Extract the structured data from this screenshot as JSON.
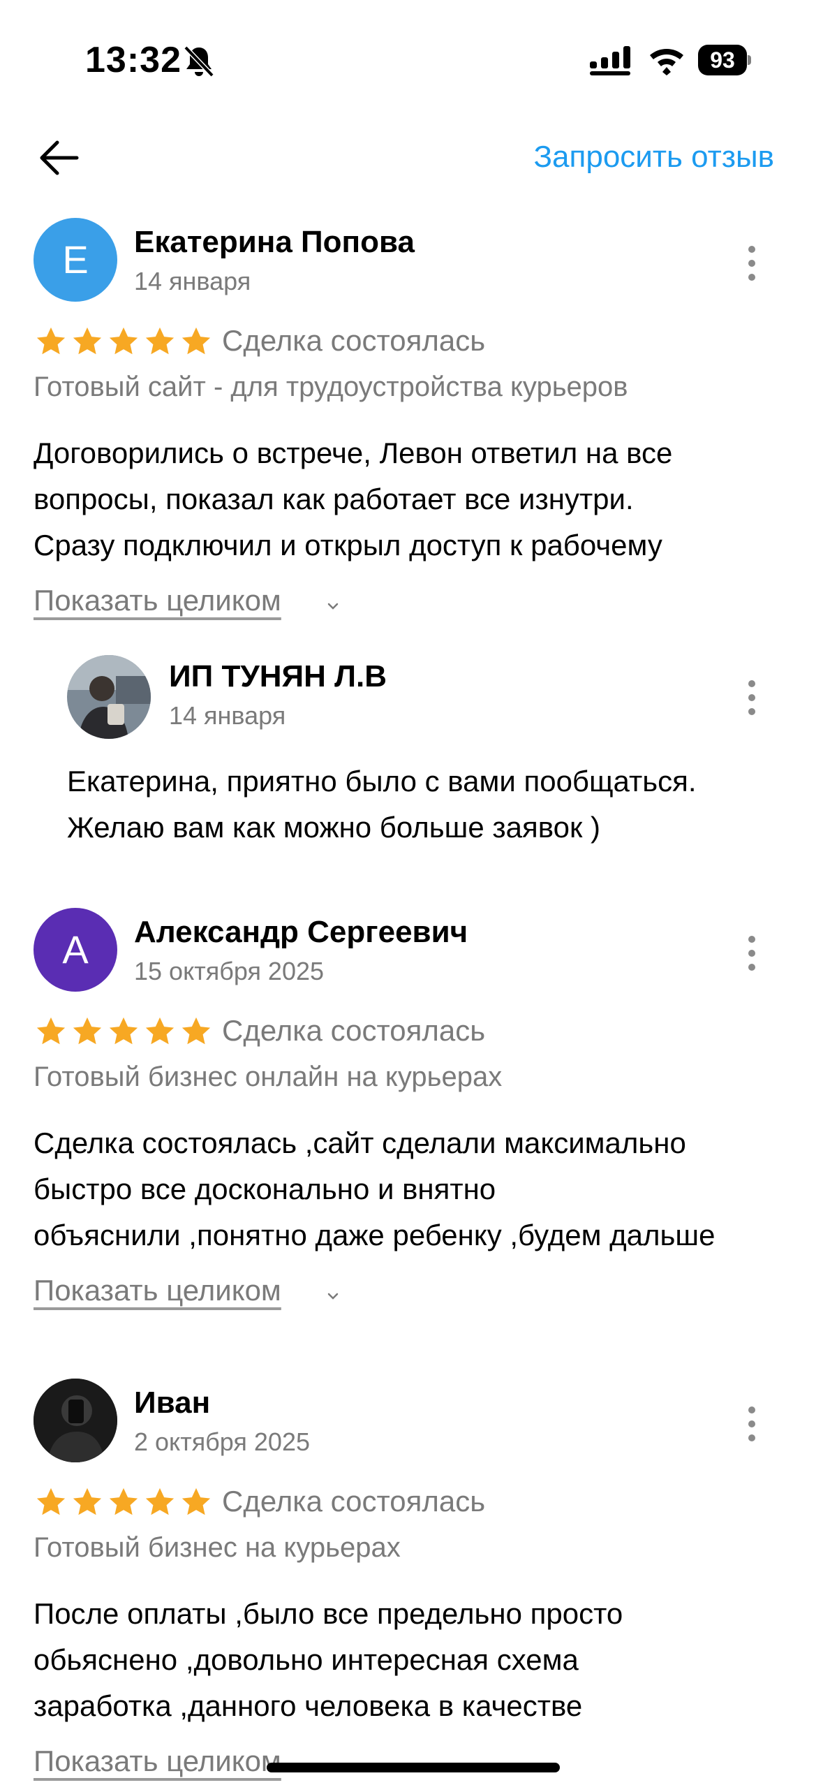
{
  "status_bar": {
    "time": "13:32",
    "battery": "93"
  },
  "nav": {
    "request_review": "Запросить отзыв"
  },
  "colors": {
    "accent": "#1c9bf0",
    "star": "#f7a823",
    "muted": "#7a7a7a"
  },
  "reviews": [
    {
      "avatar_letter": "Е",
      "avatar_color": "#3a9fe8",
      "author": "Екатерина Попова",
      "date": "14 января",
      "rating": 5,
      "status": "Сделка состоялась",
      "product": "Готовый сайт - для трудоустройства курьеров",
      "text_lines": [
        "Договорились о встрече, Левон ответил на все",
        "вопросы, показал как работает все изнутри.",
        "Сразу подключил и открыл доступ к рабочему"
      ],
      "show_full": "Показать целиком",
      "reply": {
        "author": "ИП ТУНЯН Л.В",
        "date": "14 января",
        "text_lines": [
          "Екатерина, приятно было с вами пообщаться.",
          "Желаю вам как можно больше заявок )"
        ]
      }
    },
    {
      "avatar_letter": "А",
      "avatar_color": "#5a2db3",
      "author": "Александр Сергеевич",
      "date": "15 октября 2025",
      "rating": 5,
      "status": "Сделка состоялась",
      "product": "Готовый бизнес онлайн на курьерах",
      "text_lines": [
        "Сделка состоялась ,сайт сделали максимально",
        "быстро все досконально и внятно",
        "объяснили ,понятно даже ребенку ,будем дальше"
      ],
      "show_full": "Показать целиком"
    },
    {
      "author": "Иван",
      "date": "2 октября 2025",
      "rating": 5,
      "status": "Сделка состоялась",
      "product": "Готовый бизнес на курьерах",
      "text_lines": [
        "После оплаты ,было все предельно просто",
        "обьяснено ,довольно интересная схема",
        "заработка ,данного человека в качестве"
      ],
      "show_full": "Показать целиком"
    }
  ]
}
